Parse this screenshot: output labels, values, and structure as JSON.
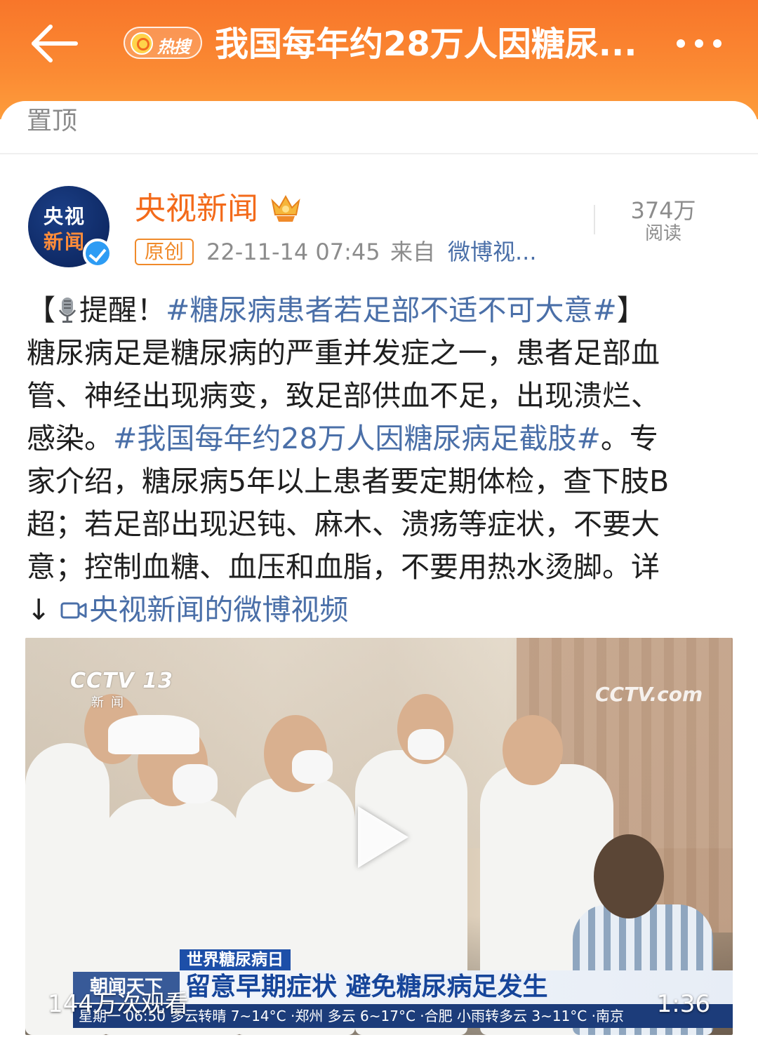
{
  "header": {
    "hot_label": "热搜",
    "title": "我国每年约28万人因糖尿...",
    "accent_color": "#f8762a"
  },
  "pinned": {
    "label": "置顶"
  },
  "post": {
    "author": {
      "name": "央视新闻",
      "avatar_line1": "央视",
      "avatar_line2": "新闻",
      "verified": true,
      "vip_icon": "crown-icon"
    },
    "original_tag": "原创",
    "time": "22-11-14 07:45",
    "from_label": "来自",
    "source": "微博视...",
    "read_count": "374万",
    "read_label": "阅读",
    "body": {
      "l1_open": "【",
      "l1_text": "提醒！",
      "l1_topic": "#糖尿病患者若足部不适不可大意#",
      "l1_close": "】",
      "l2": "糖尿病足是糖尿病的严重并发症之一，患者足部血",
      "l3": "管、神经出现病变，致足部供血不足，出现溃烂、",
      "l4_pre": "感染。",
      "l4_topic": "#我国每年约28万人因糖尿病足截肢#",
      "l4_post": "。专",
      "l5": "家介绍，糖尿病5年以上患者要定期体检，查下肢B",
      "l6": "超；若足部出现迟钝、麻木、溃疡等症状，不要大",
      "l7": "意；控制血糖、血压和血脂，不要用热水烫脚。详",
      "l8_arrow": "↓",
      "l8_link": "央视新闻的微博视频"
    },
    "video": {
      "logo": "CCTV 13",
      "channel": "新闻",
      "watermark": "CCTV.com",
      "ticker_tag": "世界糖尿病日",
      "ticker_headline": "留意早期症状 避免糖尿病足发生",
      "program": "朝闻天下",
      "weather": "星期一 06:50 多云转晴 7~14°C ·郑州 多云 6~17°C ·合肥 小雨转多云 3~11°C ·南京",
      "views": "144万次观看",
      "duration": "1:36"
    }
  }
}
